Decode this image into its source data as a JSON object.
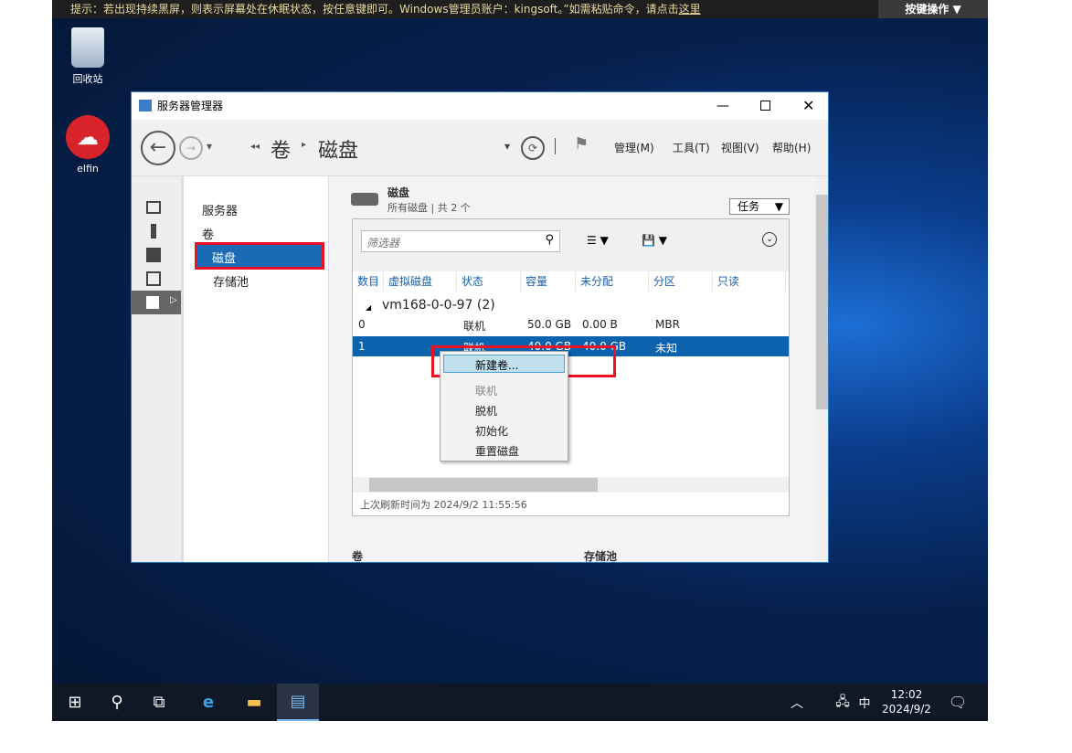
{
  "notice": {
    "text": "提示：若出现持续黑屏，则表示屏幕处在休眠状态，按任意键即可。Windows管理员账户：kingsoft。”如需粘贴命令，请点击",
    "link": "这里",
    "keyops": "按键操作"
  },
  "desktop": {
    "recycle": "回收站",
    "elfin": "elfin"
  },
  "window": {
    "title": "服务器管理器",
    "breadcrumb": [
      "卷",
      "磁盘"
    ],
    "menus": [
      "管理(M)",
      "工具(T)",
      "视图(V)",
      "帮助(H)"
    ]
  },
  "nav": {
    "items": [
      "服务器",
      "卷",
      "磁盘",
      "存储池"
    ]
  },
  "panel": {
    "title": "磁盘",
    "subtitle": "所有磁盘 | 共 2 个",
    "tasks": "任务",
    "filter_placeholder": "筛选器",
    "columns": [
      "数目",
      "虚拟磁盘",
      "状态",
      "容量",
      "未分配",
      "分区",
      "只读"
    ],
    "group": "vm168-0-0-97 (2)",
    "rows": [
      [
        "0",
        "",
        "联机",
        "50.0 GB",
        "0.00 B",
        "MBR",
        ""
      ],
      [
        "1",
        "",
        "联机",
        "40.0 GB",
        "40.0 GB",
        "未知",
        ""
      ]
    ],
    "refresh": "上次刷新时间为 2024/9/2 11:55:56"
  },
  "context_menu": [
    "新建卷...",
    "联机",
    "脱机",
    "初始化",
    "重置磁盘"
  ],
  "bottom": {
    "left": "卷",
    "right": "存储池"
  },
  "taskbar": {
    "time": "12:02",
    "date": "2024/9/2",
    "ime": "中"
  }
}
